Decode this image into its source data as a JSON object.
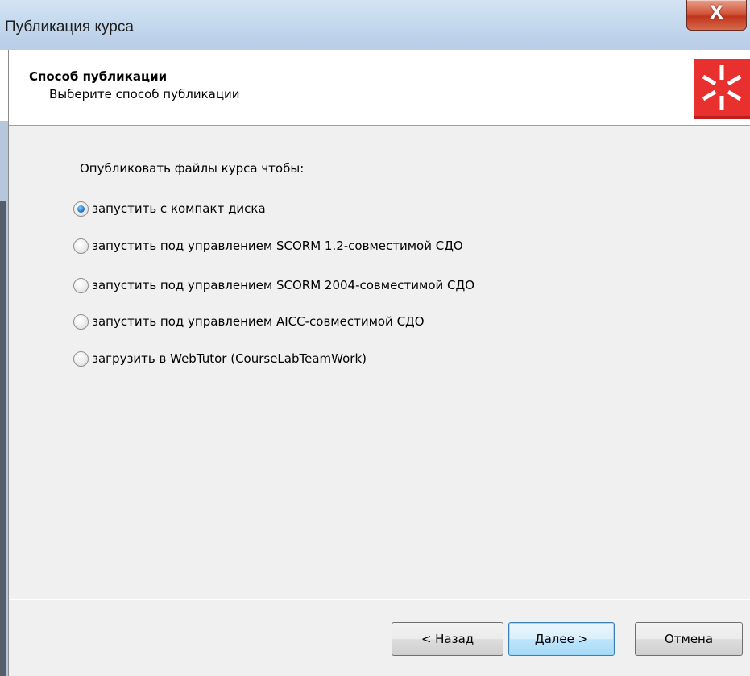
{
  "window": {
    "title": "Публикация курса",
    "close_label": "X"
  },
  "header": {
    "title": "Способ публикации",
    "subtitle": "Выберите способ публикации",
    "logo_icon": "courselab-asterisk-icon",
    "logo_color": "#e8312f"
  },
  "content": {
    "prompt": "Опубликовать файлы курса чтобы:",
    "options": [
      {
        "label": "запустить с компакт диска",
        "checked": true
      },
      {
        "label": "запустить под управлением SCORM 1.2-совместимой СДО",
        "checked": false
      },
      {
        "label": "запустить под управлением SCORM 2004-совместимой СДО",
        "checked": false
      },
      {
        "label": "запустить под управлением AICC-совместимой СДО",
        "checked": false
      },
      {
        "label": "загрузить в WebTutor (CourseLabTeamWork)",
        "checked": false
      }
    ]
  },
  "buttons": {
    "back": "< Назад",
    "next": "Далее >",
    "cancel": "Отмена"
  }
}
